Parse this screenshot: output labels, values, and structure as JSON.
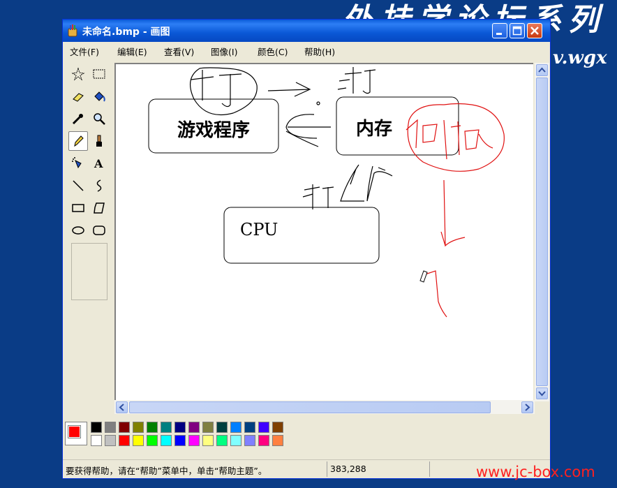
{
  "background": {
    "title_text": "外挂学论坛系列",
    "url_text": "v.wgx",
    "watermark": "www.jc-box.com"
  },
  "window": {
    "title": "未命名.bmp - 画图"
  },
  "menu": {
    "items": [
      "文件(F)",
      "编辑(E)",
      "查看(V)",
      "图像(I)",
      "颜色(C)",
      "帮助(H)"
    ]
  },
  "tools": [
    "free-form-select",
    "select",
    "eraser",
    "fill",
    "pick-color",
    "magnifier",
    "pencil",
    "brush",
    "airbrush",
    "text",
    "line",
    "curve",
    "rectangle",
    "polygon",
    "ellipse",
    "rounded-rectangle"
  ],
  "canvas": {
    "box_game": "游戏程序",
    "box_memory": "内存",
    "box_cpu": "CPU"
  },
  "palette": {
    "foreground": "#ff0000",
    "background": "#ffffff",
    "colors_row1": [
      "#000000",
      "#808080",
      "#800000",
      "#808000",
      "#008000",
      "#008080",
      "#000080",
      "#800080",
      "#808040",
      "#004040",
      "#0080ff",
      "#004080",
      "#4000ff",
      "#804000"
    ],
    "colors_row2": [
      "#ffffff",
      "#c0c0c0",
      "#ff0000",
      "#ffff00",
      "#00ff00",
      "#00ffff",
      "#0000ff",
      "#ff00ff",
      "#ffff80",
      "#00ff80",
      "#80ffff",
      "#8080ff",
      "#ff0080",
      "#ff8040"
    ]
  },
  "status": {
    "help_text": "要获得帮助，请在“帮助”菜单中，单击“帮助主题”。",
    "coords": "383,288"
  }
}
